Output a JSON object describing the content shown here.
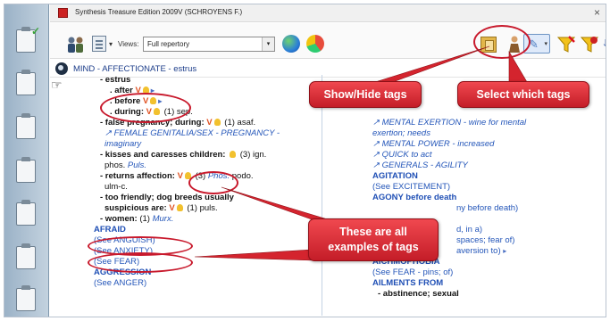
{
  "window": {
    "title": "Synthesis Treasure Edition 2009V (SCHROYENS F.)",
    "close": "×"
  },
  "toolbar": {
    "views_label": "Views:",
    "views_value": "Full repertory"
  },
  "breadcrumb": "MIND - AFFECTIONATE - estrus",
  "left": {
    "estrus": "- estrus",
    "after": ". after",
    "before": ". before",
    "during": ". during:",
    "during_rest": "(1) sep.",
    "false_preg": "- false pregnancy; during:",
    "false_preg_rest": "(1) asaf.",
    "ref_female": "FEMALE GENITALIA/SEX - PREGNANCY -",
    "imaginary": "imaginary",
    "kisses": "- kisses and caresses children:",
    "kisses_rest": "(3) ign.",
    "phos": "phos.",
    "puls": "Puls.",
    "returns": "- returns affection:",
    "returns_n": "(3)",
    "returns_phos": "Phos.",
    "returns_podo": "podo.",
    "ulm": "ulm-c.",
    "too_friendly": "- too friendly; dog breeds usually",
    "suspicious": "suspicious are:",
    "suspicious_rest": "(1) puls.",
    "women": "- women:",
    "women_n": "(1)",
    "murx": "Murx.",
    "afraid": "AFRAID",
    "see_anguish": "(See ANGUISH)",
    "see_anxiety": "(See ANXIETY)",
    "see_fear": "(See FEAR)",
    "aggression": "AGGRESSION",
    "see_anger": "(See ANGER)"
  },
  "right": {
    "r0": "MENTAL EXERTION - wine for mental",
    "r1": "exertion; needs",
    "r2": "MENTAL POWER - increased",
    "r3": "QUICK to act",
    "r4": "GENERALS - AGILITY",
    "agitation": "AGITATION",
    "see_excitement": "(See EXCITEMENT)",
    "agony": "AGONY before death",
    "agony_frag": "ny before death)",
    "d_frag": "d, in a)",
    "spaces_frag": "spaces; fear of)",
    "aversion_frag": "aversion to)",
    "aichmophobia": "AICHMOPHOBIA",
    "see_fear_pins": "(See FEAR - pins; of)",
    "ailments": "AILMENTS FROM",
    "abstinence": "- abstinence; sexual"
  },
  "callouts": {
    "show_hide": "Show/Hide tags",
    "select": "Select which tags",
    "examples_1": "These are all",
    "examples_2": "examples of tags"
  },
  "tag_glyphs": {
    "v": "V",
    "arrow": "↗",
    "flag": "▸",
    "pencil": "✎",
    "drop": "▾",
    "pointer": "☞"
  },
  "colors": {
    "callout_red": "#c41d28",
    "link_blue": "#2456b9",
    "v_tag": "#e05020",
    "bulb_tag": "#f2c12e"
  }
}
